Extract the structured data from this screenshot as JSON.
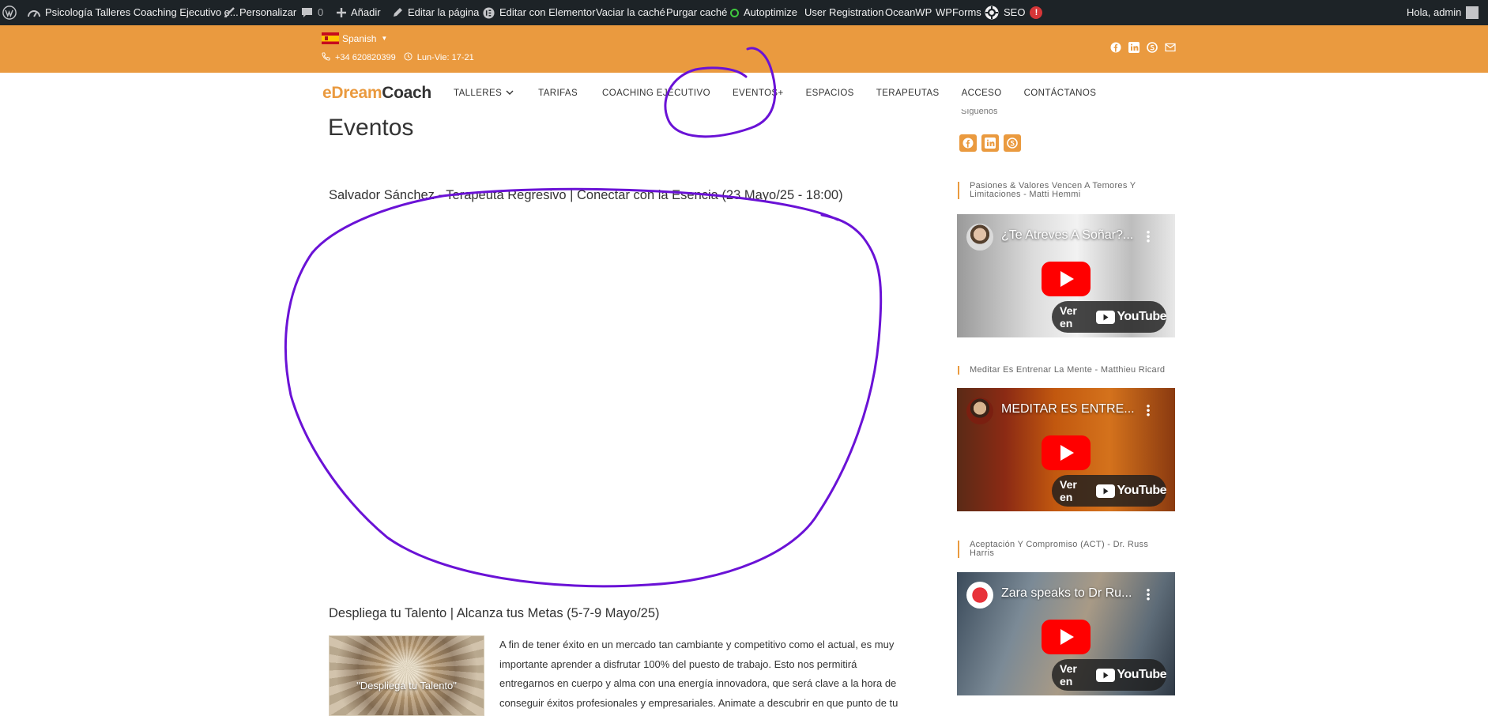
{
  "admin_bar": {
    "site_name": "Psicología Talleres Coaching Ejecutivo e...",
    "customize": "Personalizar",
    "comments_count": "0",
    "add_new": "Añadir",
    "edit_page": "Editar la página",
    "edit_elementor": "Editar con Elementor",
    "clear_cache": "Vaciar la caché",
    "purge_cache": "Purgar caché",
    "autoptimize": "Autoptimize",
    "user_registration": "User Registration",
    "oceanwp": "OceanWP",
    "wpforms": "WPForms",
    "seo": "SEO",
    "seo_badge": "!",
    "greeting": "Hola, admin"
  },
  "top_bar": {
    "language": "Spanish",
    "phone": "+34 620820399",
    "hours": "Lun-Vie: 17-21",
    "socials": [
      "facebook-icon",
      "linkedin-icon",
      "skype-icon",
      "mail-icon"
    ]
  },
  "header": {
    "logo_part1": "eDream",
    "logo_part2": "Coach",
    "nav": [
      "TALLERES",
      "TARIFAS",
      "COACHING EJECUTIVO",
      "EVENTOS+",
      "ESPACIOS",
      "TERAPEUTAS",
      "ACCESO",
      "CONTÁCTANOS"
    ]
  },
  "main": {
    "page_title": "Eventos",
    "posts": [
      {
        "title": "Salvador Sánchez - Terapeuta Regresivo | Conectar con la Esencia (23 Mayo/25 - 18:00)"
      },
      {
        "title": "Despliega tu Talento | Alcanza tus Metas (5-7-9 Mayo/25)",
        "thumb_caption": "\"Despliega tu Talento\"",
        "excerpt": "A fin de tener éxito en un mercado tan cambiante y competitivo como el actual, es muy importante aprender a disfrutar 100% del puesto de trabajo. Esto nos permitirá entregarnos en cuerpo y alma con una energía innovadora, que será clave a la hora de conseguir éxitos profesionales y empresariales. Animate a descubrir en que punto de tu desarrollo personal y"
      }
    ]
  },
  "sidebar": {
    "cut_heading": "Síguenos",
    "socials": [
      "facebook-icon",
      "linkedin-icon",
      "skype-icon"
    ],
    "videos": [
      {
        "heading": "Pasiones & Valores Vencen A Temores Y Limitaciones - Matti Hemmi",
        "video_title": "¿Te Atreves A Soñar?...",
        "watch_label": "Ver en",
        "yt_label": "YouTube"
      },
      {
        "heading": "Meditar Es Entrenar La Mente - Matthieu Ricard",
        "video_title": "MEDITAR ES ENTRE...",
        "watch_label": "Ver en",
        "yt_label": "YouTube"
      },
      {
        "heading": "Aceptación Y Compromiso (ACT) - Dr. Russ Harris",
        "video_title": "Zara speaks to Dr Ru...",
        "watch_label": "Ver en",
        "yt_label": "YouTube"
      }
    ]
  },
  "colors": {
    "accent": "#ea9a3f",
    "admin_bar": "#1d2327",
    "annotation": "#6a12d6",
    "youtube_red": "#ff0000"
  }
}
